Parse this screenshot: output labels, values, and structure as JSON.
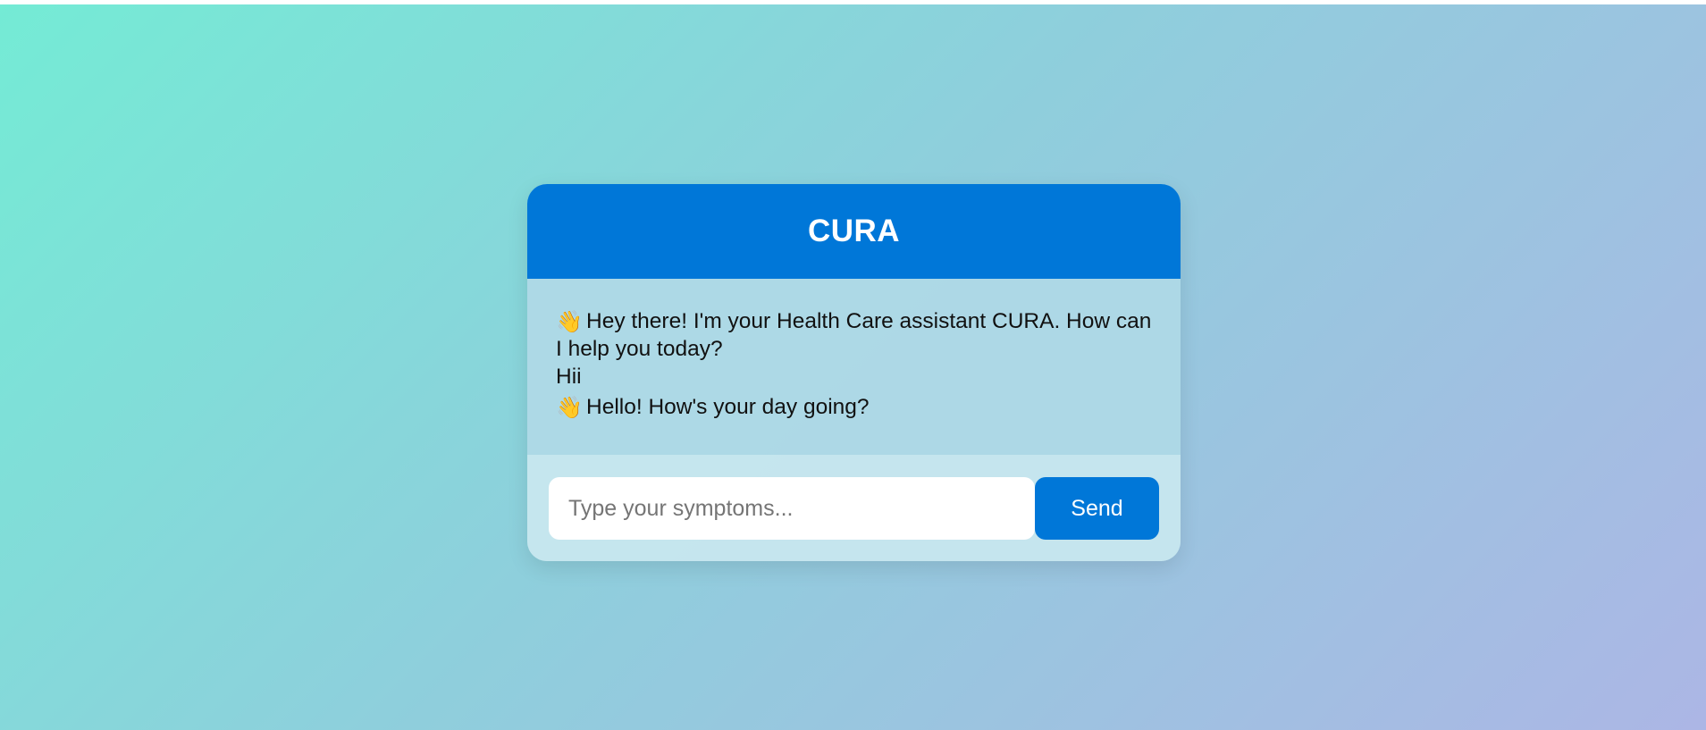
{
  "header": {
    "title": "CURA"
  },
  "messages": [
    {
      "role": "bot",
      "icon": "waving-hand-icon",
      "icon_glyph": "👋",
      "text": "Hey there! I'm your Health Care assistant CURA. How can I help you today?"
    },
    {
      "role": "user",
      "text": "Hii"
    },
    {
      "role": "bot",
      "icon": "waving-hand-icon",
      "icon_glyph": "👋",
      "text": "Hello! How's your day going?"
    }
  ],
  "composer": {
    "placeholder": "Type your symptoms...",
    "value": "",
    "send_label": "Send"
  },
  "colors": {
    "accent": "#0077d8",
    "gradient_start": "#74ebd5",
    "gradient_end": "#acb6e5"
  }
}
